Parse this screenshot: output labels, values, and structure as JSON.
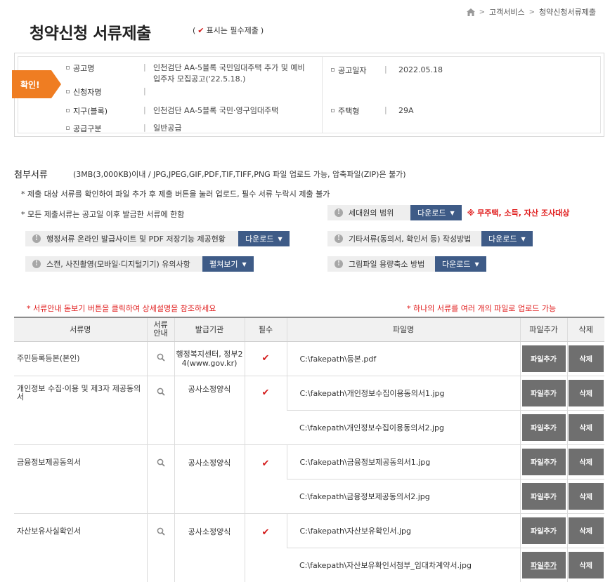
{
  "breadcrumb": {
    "item1": "고객서비스",
    "item2": "청약신청서류제출",
    "sep": ">"
  },
  "title": "청약신청 서류제출",
  "required_note": {
    "open": "(",
    "check": "✔",
    "text": "표시는 필수제출",
    "close": ")"
  },
  "info": {
    "tag": "확인!",
    "bar": "|",
    "notice_name_label": "공고명",
    "notice_name_value_line1": "인천검단 AA-5블록 국민임대주택 추가 및 예비",
    "notice_name_value_line2": "입주자 모집공고('22.5.18.)",
    "applicant_label": "신청자명",
    "applicant_value": "",
    "district_label": "지구(블록)",
    "district_value": "인천검단 AA-5블록 국민·영구임대주택",
    "supply_label": "공급구분",
    "supply_value": "일반공급",
    "notice_date_label": "공고일자",
    "notice_date_value": "2022.05.18",
    "house_type_label": "주택형",
    "house_type_value": "29A"
  },
  "attach": {
    "label": "첨부서류",
    "desc": "(3MB(3,000KB)이내 / JPG,JPEG,GIF,PDF,TIF,TIFF,PNG 파일 업로드 가능, 압축파일(ZIP)은 불가)",
    "note1": "* 제출 대상 서류를 확인하여 파일 추가 후 제출 버튼을 눌러 업로드, 필수 서류 누락시 제출 불가",
    "note2": "* 모든 제출서류는 공고일 이후 발급한 서류에 한함"
  },
  "downloads": {
    "household": {
      "label": "세대원의 범위",
      "btn": "다운로드",
      "note": "※ 무주택, 소득, 자산 조사대상"
    },
    "admin": {
      "label": "행정서류 온라인 발급사이트 및 PDF 저장기능 제공현황",
      "btn": "다운로드"
    },
    "other": {
      "label": "기타서류(동의서, 확인서 등) 작성방법",
      "btn": "다운로드"
    },
    "scan": {
      "label": "스캔, 사진촬영(모바일·디지털기기) 유의사항",
      "btn": "펼쳐보기"
    },
    "image": {
      "label": "그림파일 용량축소 방법",
      "btn": "다운로드"
    }
  },
  "red_notes": {
    "left": "* 서류안내 돋보기 버튼을 클릭하여 상세설명을 참조하세요",
    "right": "* 하나의 서류를 여러 개의 파일로 업로드 가능"
  },
  "table": {
    "headers": {
      "name": "서류명",
      "guide_line1": "서류",
      "guide_line2": "안내",
      "issuer": "발급기관",
      "required": "필수",
      "file": "파일명",
      "add": "파일추가",
      "delete": "삭제"
    },
    "add_label": "파일추가",
    "del_label": "삭제",
    "check": "✔",
    "rows": [
      {
        "name": "주민등록등본(본인)",
        "issuer": "행정복지센터, 정부24(www.gov.kr)",
        "file": "C:\\fakepath\\등본.pdf"
      },
      {
        "name": "개인정보 수집·이용 및 제3자 제공동의서",
        "issuer": "공사소정양식",
        "file1": "C:\\fakepath\\개인정보수집이용동의서1.jpg",
        "file2": "C:\\fakepath\\개인정보수집이용동의서2.jpg"
      },
      {
        "name": "금융정보제공동의서",
        "issuer": "공사소정양식",
        "file1": "C:\\fakepath\\금융정보제공동의서1.jpg",
        "file2": "C:\\fakepath\\금융정보제공동의서2.jpg"
      },
      {
        "name": "자산보유사실확인서",
        "issuer": "공사소정양식",
        "file1": "C:\\fakepath\\자산보유확인서.jpg",
        "file2": "C:\\fakepath\\자산보유확인서첨부_임대차계약서.jpg"
      }
    ]
  }
}
